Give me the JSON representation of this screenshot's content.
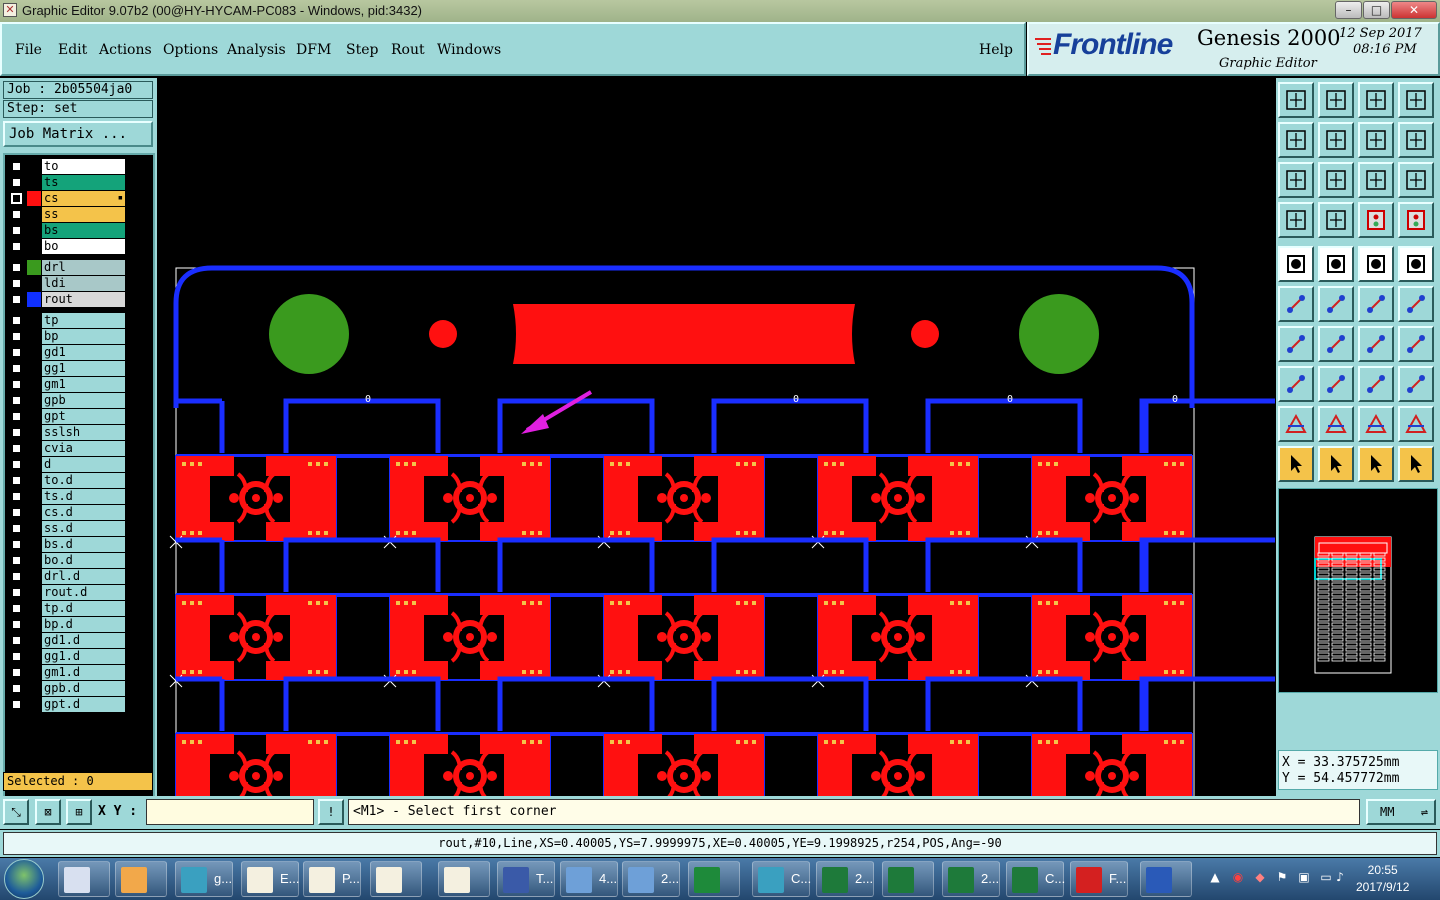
{
  "window": {
    "title": "Graphic Editor 9.07b2 (00@HY-HYCAM-PC083 - Windows, pid:3432)",
    "controls": [
      "–",
      "□",
      "✕"
    ]
  },
  "menu": {
    "items": [
      "File",
      "Edit",
      "Actions",
      "Options",
      "Analysis",
      "DFM",
      "Step",
      "Rout",
      "Windows"
    ],
    "help": "Help"
  },
  "brand": {
    "logo": "Frontline",
    "product": "Genesis 2000",
    "subtitle": "Graphic Editor",
    "date": "12  Sep  2017",
    "time": "08:16  PM"
  },
  "job": {
    "job_label": "Job : 2b05504ja0",
    "step_label": "Step: set",
    "matrix_button": "Job Matrix ..."
  },
  "layers": [
    {
      "name": "to",
      "color": "#ffffff",
      "bg": "#ffffff",
      "group": 1
    },
    {
      "name": "ts",
      "color": "#ffffff",
      "bg": "#14a37a",
      "group": 1
    },
    {
      "name": "cs",
      "color": "#ff1010",
      "bg": "#f4c34a",
      "group": 1,
      "active": true
    },
    {
      "name": "ss",
      "color": "#ffffff",
      "bg": "#f4c34a",
      "group": 1
    },
    {
      "name": "bs",
      "color": "#ffffff",
      "bg": "#14a37a",
      "group": 1
    },
    {
      "name": "bo",
      "color": "#ffffff",
      "bg": "#ffffff",
      "group": 1
    },
    {
      "name": "drl",
      "color": "#3a9a1e",
      "bg": "#a8c8c8",
      "group": 2
    },
    {
      "name": "ldi",
      "color": "#000000",
      "bg": "#a8c8c8",
      "group": 2
    },
    {
      "name": "rout",
      "color": "#1030ff",
      "bg": "#d8d8d8",
      "group": 2
    },
    {
      "name": "tp",
      "color": "#000000",
      "bg": "#9ed8d8",
      "group": 3
    },
    {
      "name": "bp",
      "color": "#000000",
      "bg": "#9ed8d8",
      "group": 3
    },
    {
      "name": "gd1",
      "color": "#000000",
      "bg": "#9ed8d8",
      "group": 3
    },
    {
      "name": "gg1",
      "color": "#000000",
      "bg": "#9ed8d8",
      "group": 3
    },
    {
      "name": "gm1",
      "color": "#000000",
      "bg": "#9ed8d8",
      "group": 3
    },
    {
      "name": "gpb",
      "color": "#000000",
      "bg": "#9ed8d8",
      "group": 3
    },
    {
      "name": "gpt",
      "color": "#000000",
      "bg": "#9ed8d8",
      "group": 3
    },
    {
      "name": "sslsh",
      "color": "#000000",
      "bg": "#9ed8d8",
      "group": 3
    },
    {
      "name": "cvia",
      "color": "#000000",
      "bg": "#9ed8d8",
      "group": 3
    },
    {
      "name": "d",
      "color": "#000000",
      "bg": "#9ed8d8",
      "group": 3
    },
    {
      "name": "to.d",
      "color": "#000000",
      "bg": "#9ed8d8",
      "group": 3
    },
    {
      "name": "ts.d",
      "color": "#000000",
      "bg": "#9ed8d8",
      "group": 3
    },
    {
      "name": "cs.d",
      "color": "#000000",
      "bg": "#9ed8d8",
      "group": 3
    },
    {
      "name": "ss.d",
      "color": "#000000",
      "bg": "#9ed8d8",
      "group": 3
    },
    {
      "name": "bs.d",
      "color": "#000000",
      "bg": "#9ed8d8",
      "group": 3
    },
    {
      "name": "bo.d",
      "color": "#000000",
      "bg": "#9ed8d8",
      "group": 3
    },
    {
      "name": "drl.d",
      "color": "#000000",
      "bg": "#9ed8d8",
      "group": 3
    },
    {
      "name": "rout.d",
      "color": "#000000",
      "bg": "#9ed8d8",
      "group": 3
    },
    {
      "name": "tp.d",
      "color": "#000000",
      "bg": "#9ed8d8",
      "group": 3
    },
    {
      "name": "bp.d",
      "color": "#000000",
      "bg": "#9ed8d8",
      "group": 3
    },
    {
      "name": "gd1.d",
      "color": "#000000",
      "bg": "#9ed8d8",
      "group": 3
    },
    {
      "name": "gg1.d",
      "color": "#000000",
      "bg": "#9ed8d8",
      "group": 3
    },
    {
      "name": "gm1.d",
      "color": "#000000",
      "bg": "#9ed8d8",
      "group": 3
    },
    {
      "name": "gpb.d",
      "color": "#000000",
      "bg": "#9ed8d8",
      "group": 3
    },
    {
      "name": "gpt.d",
      "color": "#000000",
      "bg": "#9ed8d8",
      "group": 3
    }
  ],
  "selected": "Selected : 0",
  "canvas": {
    "colors": {
      "rout": "#1a2eff",
      "copper": "#ff1010",
      "drill": "#3a9a1e",
      "pad": "#f4c34a",
      "arrow": "#e020e0"
    },
    "marker": "0"
  },
  "coords": {
    "x": "X = 33.375725mm",
    "y": "Y = 54.457772mm"
  },
  "command": {
    "xy_label": "X Y :",
    "xy_value": "",
    "bang": "!",
    "prompt": "<M1> - Select first corner",
    "units": "MM"
  },
  "status": "rout,#10,Line,XS=0.40005,YS=7.9999975,XE=0.40005,YE=9.1998925,r254,POS,Ang=-90",
  "taskbar": {
    "items": [
      {
        "label": "",
        "icon": "calculator-icon",
        "color": "#d8e0f0"
      },
      {
        "label": "",
        "icon": "shell-icon",
        "color": "#f2a84a"
      },
      {
        "label": "g...",
        "icon": "genesis-icon",
        "color": "#3aa0c0"
      },
      {
        "label": "E...",
        "icon": "editor-icon",
        "color": "#f4f0e0"
      },
      {
        "label": "P...",
        "icon": "editor-icon",
        "color": "#f4f0e0"
      },
      {
        "label": "",
        "icon": "editor-icon",
        "color": "#f4f0e0"
      },
      {
        "label": "",
        "icon": "editor-icon",
        "color": "#f4f0e0"
      },
      {
        "label": "T...",
        "icon": "floppy-icon",
        "color": "#3a5aa8"
      },
      {
        "label": "4...",
        "icon": "document-icon",
        "color": "#6ea0d8"
      },
      {
        "label": "2...",
        "icon": "document-icon",
        "color": "#6ea0d8"
      },
      {
        "label": "",
        "icon": "frontline-icon",
        "color": "#1e8a3a"
      },
      {
        "label": "C...",
        "icon": "genesis-icon",
        "color": "#3aa0c0"
      },
      {
        "label": "2...",
        "icon": "excel-icon",
        "color": "#1e7a3a"
      },
      {
        "label": "",
        "icon": "excel-icon",
        "color": "#1e7a3a"
      },
      {
        "label": "2...",
        "icon": "excel-icon",
        "color": "#1e7a3a"
      },
      {
        "label": "C...",
        "icon": "excel-icon",
        "color": "#1e7a3a"
      },
      {
        "label": "F...",
        "icon": "foxit-icon",
        "color": "#d42020"
      },
      {
        "label": "",
        "icon": "frontline-icon",
        "color": "#2a5ab8"
      }
    ],
    "time": "20:55",
    "date": "2017/9/12"
  }
}
